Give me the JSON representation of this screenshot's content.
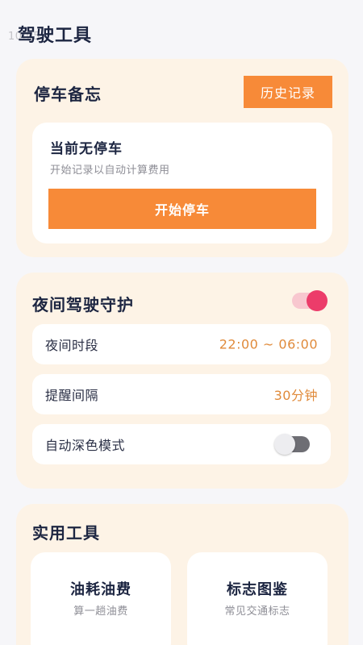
{
  "status_ghost": "10:05",
  "page": {
    "title": "驾驶工具"
  },
  "parking": {
    "title": "停车备忘",
    "history_button": "历史记录",
    "empty_title": "当前无停车",
    "empty_subtitle": "开始记录以自动计算费用",
    "start_button": "开始停车"
  },
  "night_guard": {
    "title": "夜间驾驶守护",
    "enabled": true,
    "rows": [
      {
        "label": "夜间时段",
        "value": "22:00 ~ 06:00"
      },
      {
        "label": "提醒间隔",
        "value": "30分钟"
      },
      {
        "label": "自动深色模式",
        "toggle_on": false
      }
    ]
  },
  "tools": {
    "title": "实用工具",
    "items": [
      {
        "title": "油耗油费",
        "subtitle": "算一趟油费"
      },
      {
        "title": "标志图鉴",
        "subtitle": "常见交通标志"
      }
    ]
  },
  "colors": {
    "accent_orange": "#f78a38",
    "card_bg": "#fdf3e6",
    "toggle_on": "#ec3c6a",
    "value_text": "#e08a3a"
  }
}
